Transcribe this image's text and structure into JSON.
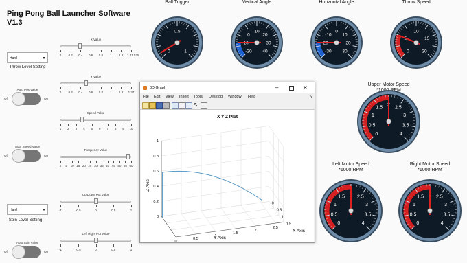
{
  "app": {
    "title": "Ping Pong Ball Launcher Software V1.3"
  },
  "left_panel": {
    "throw_level": {
      "selected": "Hard",
      "label": "Throw Level Setting"
    },
    "spin_level": {
      "selected": "Hard",
      "label": "Spin Level Setting"
    },
    "auto_pos": {
      "label": "Auto Pos Value",
      "off": "Off",
      "on": "On"
    },
    "auto_speed": {
      "label": "Auto Speed Value",
      "off": "Off",
      "on": "On"
    },
    "auto_spin": {
      "label": "Auto Spin Value",
      "off": "Off",
      "on": "On"
    }
  },
  "sliders": [
    {
      "name": "x-value-slider",
      "label": "X Value",
      "ticks": [
        "0",
        "0.2",
        "0.4",
        "0.6",
        "0.8",
        "1",
        "1.2",
        "1.41.525"
      ],
      "value_fraction": 0.27
    },
    {
      "name": "y-value-slider",
      "label": "Y Value",
      "ticks": [
        "0",
        "0.2",
        "0.4",
        "0.6",
        "0.8",
        "1",
        "1.2",
        "1.37"
      ],
      "value_fraction": 0.36
    },
    {
      "name": "speed-value-slider",
      "label": "Speed Value",
      "ticks": [
        "1",
        "2",
        "3",
        "4",
        "5",
        "6",
        "7",
        "8",
        "9",
        "10"
      ],
      "value_fraction": 0.3
    },
    {
      "name": "frequency-value-slider",
      "label": "Frequency Value",
      "ticks": [
        "0",
        "5",
        "10",
        "15",
        "20",
        "25",
        "30",
        "35",
        "40",
        "45",
        "50",
        "55",
        "60"
      ],
      "value_fraction": 0.98
    },
    {
      "name": "up-down-rot-slider",
      "label": "Up Down Rot Value",
      "ticks": [
        "-1",
        "-0.5",
        "0",
        "0.5",
        "1"
      ],
      "value_fraction": 0.5
    },
    {
      "name": "left-right-rot-slider",
      "label": "Left Right Rot Value",
      "ticks": [
        "-1",
        "-0.5",
        "0",
        "0.5",
        "1"
      ],
      "value_fraction": 0.5
    }
  ],
  "gauges": [
    {
      "name": "ball-trigger-gauge",
      "title": "Ball Trigger",
      "subtitle": "",
      "ticks": [
        "0",
        "0.5",
        "1"
      ],
      "value": 0.05,
      "min": 0,
      "max": 1,
      "red_band": false,
      "blue_band": false
    },
    {
      "name": "vertical-angle-gauge",
      "title": "Vertical Angle",
      "subtitle": "",
      "ticks": [
        "-20",
        "-10",
        "0",
        "10",
        "20",
        "30",
        "40"
      ],
      "value": -10,
      "min": -20,
      "max": 40,
      "red_band": false,
      "blue_band": true
    },
    {
      "name": "horizontal-angle-gauge",
      "title": "Horizontal Angle",
      "subtitle": "",
      "ticks": [
        "-30",
        "-20",
        "-10",
        "0",
        "10",
        "20",
        "30"
      ],
      "value": -20,
      "min": -30,
      "max": 30,
      "red_band": false,
      "blue_band": true
    },
    {
      "name": "throw-speed-gauge",
      "title": "Throw Speed",
      "subtitle": "",
      "ticks": [
        "0",
        "5",
        "10",
        "15",
        "20"
      ],
      "value": 5,
      "min": 0,
      "max": 20,
      "red_band": true,
      "blue_band": false
    },
    {
      "name": "upper-motor-speed-gauge",
      "title": "Upper Motor Speed",
      "subtitle": "*1000 RPM",
      "ticks": [
        "0",
        "0.5",
        "1",
        "1.5",
        "2",
        "2.5",
        "3",
        "3.5",
        "4"
      ],
      "value": 2,
      "min": 0,
      "max": 4,
      "red_band": true,
      "blue_band": false
    },
    {
      "name": "left-motor-speed-gauge",
      "title": "Left Motor Speed",
      "subtitle": "*1000 RPM",
      "ticks": [
        "0",
        "0.5",
        "1",
        "1.5",
        "2",
        "2.5",
        "3",
        "3.5",
        "4"
      ],
      "value": 2,
      "min": 0,
      "max": 4,
      "red_band": true,
      "blue_band": false
    },
    {
      "name": "right-motor-speed-gauge",
      "title": "Right Motor Speed",
      "subtitle": "*1000 RPM",
      "ticks": [
        "0",
        "0.5",
        "1",
        "1.5",
        "2",
        "2.5",
        "3",
        "3.5",
        "4"
      ],
      "value": 2,
      "min": 0,
      "max": 4,
      "red_band": true,
      "blue_band": false
    }
  ],
  "graph_window": {
    "title": "3D Graph",
    "menu": [
      "File",
      "Edit",
      "View",
      "Insert",
      "Tools",
      "Desktop",
      "Window",
      "Help"
    ],
    "plot_title": "X Y Z Plot",
    "x_label": "X Axis",
    "y_label": "Y Axis",
    "z_label": "Z Axis",
    "x_ticks": [
      "0",
      "0.5",
      "1",
      "1.5"
    ],
    "y_ticks": [
      "0",
      "0.5",
      "1",
      "1.5",
      "2",
      "2.5"
    ],
    "z_ticks": [
      "0",
      "0.2",
      "0.4",
      "0.6",
      "0.8",
      "1"
    ],
    "curve_color": "#4a90c0"
  },
  "colors": {
    "gauge_face": "#0e1a26",
    "gauge_rim": "#6e8ca8",
    "red_band": "#d42020",
    "blue_band": "#1c5fd0"
  }
}
